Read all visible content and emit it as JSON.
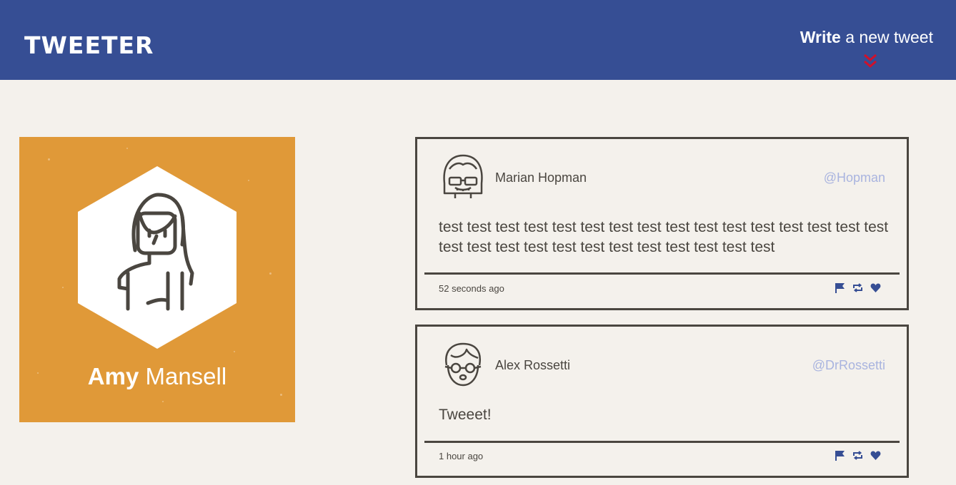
{
  "nav": {
    "brand": "TWEETER",
    "compose_bold": "Write",
    "compose_rest": " a new tweet",
    "compose_icon": "double-chevron-down-icon",
    "compose_icon_color": "#d0112b"
  },
  "colors": {
    "nav_bg": "#364e94",
    "page_bg": "#f4f1ec",
    "profile_bg": "#e09938",
    "handle": "#a9b4df",
    "border": "#4a4640"
  },
  "profile": {
    "first_name": "Amy",
    "last_name": " Mansell"
  },
  "tweets": [
    {
      "name": "Marian Hopman",
      "handle": "@Hopman",
      "text": "test test test test test test test test test test test test test test test test test test test test test test test test test test test test",
      "time": "52 seconds ago",
      "actions": [
        "flag-icon",
        "retweet-icon",
        "heart-icon"
      ]
    },
    {
      "name": "Alex Rossetti",
      "handle": "@DrRossetti",
      "text": "Tweeet!",
      "time": "1 hour ago",
      "actions": [
        "flag-icon",
        "retweet-icon",
        "heart-icon"
      ]
    }
  ]
}
